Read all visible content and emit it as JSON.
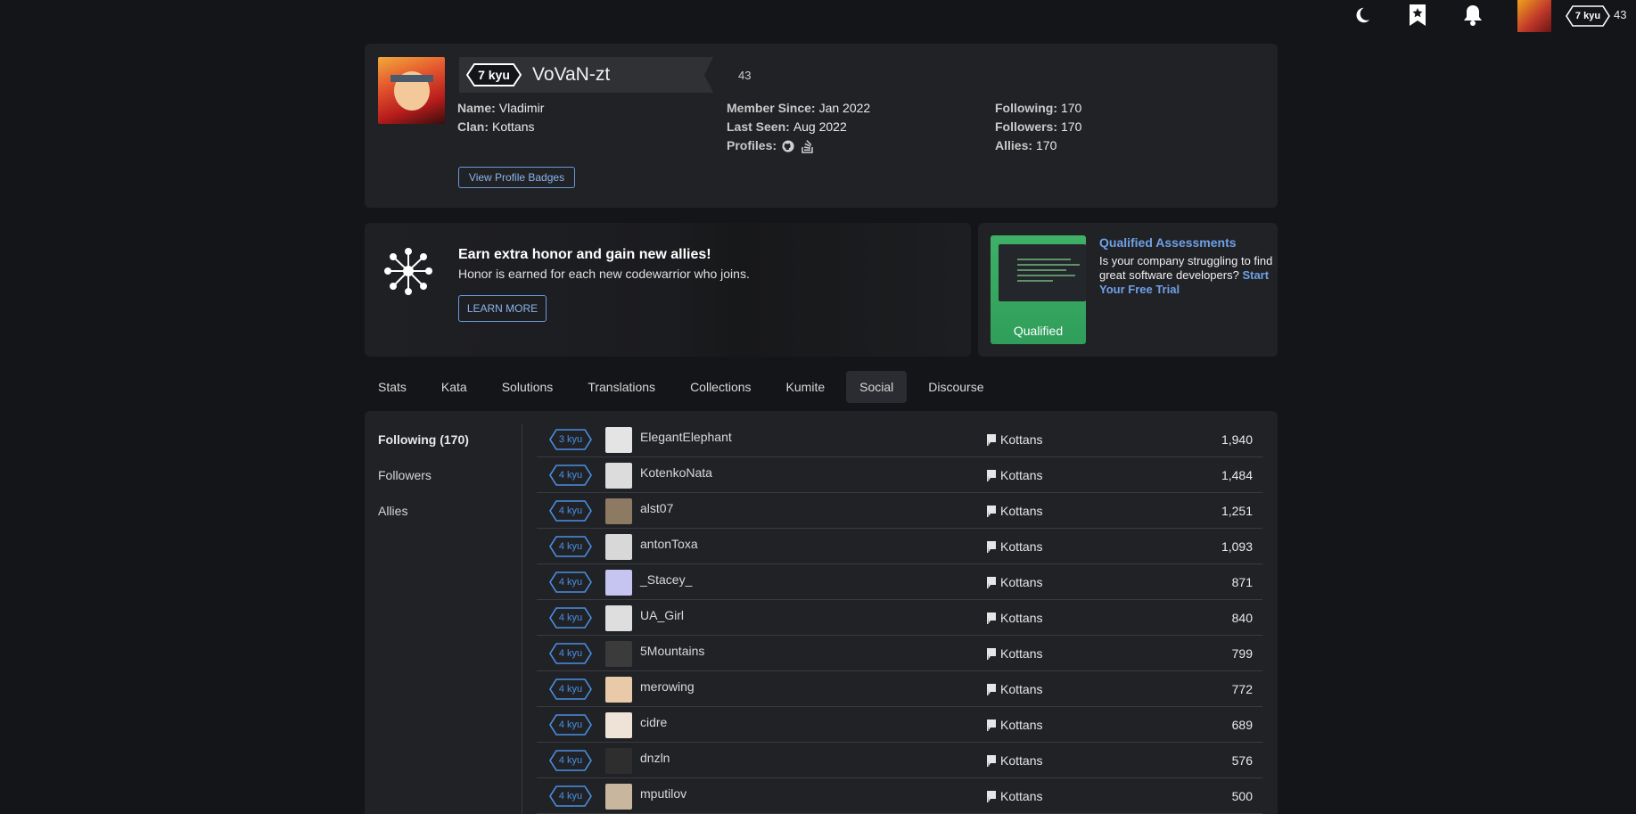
{
  "topbar": {
    "rank": "7 kyu",
    "honor": "43"
  },
  "profile": {
    "rank": "7 kyu",
    "username": "VoVaN-zt",
    "honor": "43",
    "name_label": "Name:",
    "name": "Vladimir",
    "clan_label": "Clan:",
    "clan": "Kottans",
    "member_since_label": "Member Since:",
    "member_since": "Jan 2022",
    "last_seen_label": "Last Seen:",
    "last_seen": "Aug 2022",
    "profiles_label": "Profiles:",
    "following_label": "Following:",
    "following": "170",
    "followers_label": "Followers:",
    "followers": "170",
    "allies_label": "Allies:",
    "allies": "170",
    "badges_button": "View Profile Badges"
  },
  "promo": {
    "title": "Earn extra honor and gain new allies!",
    "subtitle": "Honor is earned for each new codewarrior who joins.",
    "button": "LEARN MORE"
  },
  "qualified": {
    "thumb_label": "Qualified",
    "title": "Qualified Assessments",
    "text": "Is your company struggling to find great software developers?",
    "link": "Start Your Free Trial"
  },
  "tabs": [
    "Stats",
    "Kata",
    "Solutions",
    "Translations",
    "Collections",
    "Kumite",
    "Social",
    "Discourse"
  ],
  "active_tab": "Social",
  "social_nav": [
    "Following (170)",
    "Followers",
    "Allies"
  ],
  "users": [
    {
      "rank": "3 kyu",
      "name": "ElegantElephant",
      "clan": "Kottans",
      "honor": "1,940"
    },
    {
      "rank": "4 kyu",
      "name": "KotenkoNata",
      "clan": "Kottans",
      "honor": "1,484"
    },
    {
      "rank": "4 kyu",
      "name": "alst07",
      "clan": "Kottans",
      "honor": "1,251"
    },
    {
      "rank": "4 kyu",
      "name": "antonToxa",
      "clan": "Kottans",
      "honor": "1,093"
    },
    {
      "rank": "4 kyu",
      "name": "_Stacey_",
      "clan": "Kottans",
      "honor": "871"
    },
    {
      "rank": "4 kyu",
      "name": "UA_Girl",
      "clan": "Kottans",
      "honor": "840"
    },
    {
      "rank": "4 kyu",
      "name": "5Mountains",
      "clan": "Kottans",
      "honor": "799"
    },
    {
      "rank": "4 kyu",
      "name": "merowing",
      "clan": "Kottans",
      "honor": "772"
    },
    {
      "rank": "4 kyu",
      "name": "cidre",
      "clan": "Kottans",
      "honor": "689"
    },
    {
      "rank": "4 kyu",
      "name": "dnzln",
      "clan": "Kottans",
      "honor": "576"
    },
    {
      "rank": "4 kyu",
      "name": "mputilov",
      "clan": "Kottans",
      "honor": "500"
    }
  ]
}
